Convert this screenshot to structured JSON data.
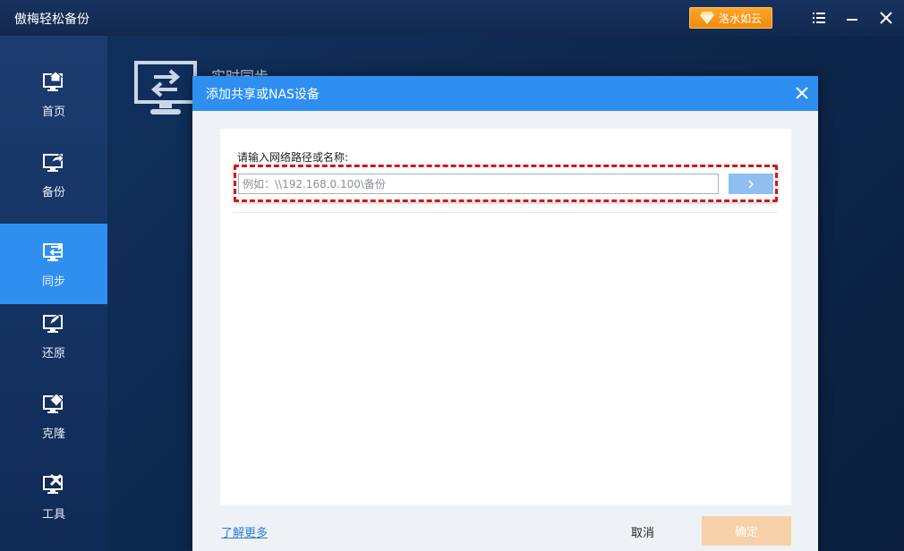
{
  "app": {
    "title": "傲梅轻松备份"
  },
  "titlebar": {
    "upgrade_label": "洛水如云"
  },
  "sidebar": {
    "items": [
      {
        "label": "首页",
        "icon": "home-monitor-icon",
        "active": false
      },
      {
        "label": "备份",
        "icon": "backup-monitor-icon",
        "active": false
      },
      {
        "label": "同步",
        "icon": "sync-monitor-icon",
        "active": true
      },
      {
        "label": "还原",
        "icon": "restore-monitor-icon",
        "active": false
      },
      {
        "label": "克隆",
        "icon": "clone-monitor-icon",
        "active": false
      },
      {
        "label": "工具",
        "icon": "tools-monitor-icon",
        "active": false
      }
    ]
  },
  "background": {
    "page_title": "实时同步"
  },
  "dialog": {
    "title": "添加共享或NAS设备",
    "field_label": "请输入网络路径或名称:",
    "path_input": {
      "value": "",
      "placeholder": "例如：\\\\192.168.0.100\\备份"
    },
    "learn_more": "了解更多",
    "cancel": "取消",
    "ok": "确定"
  },
  "colors": {
    "accent": "#2f8ff0",
    "upgrade": "#f5951a",
    "highlight": "#d01818",
    "ok_disabled": "#f9d1a8"
  }
}
